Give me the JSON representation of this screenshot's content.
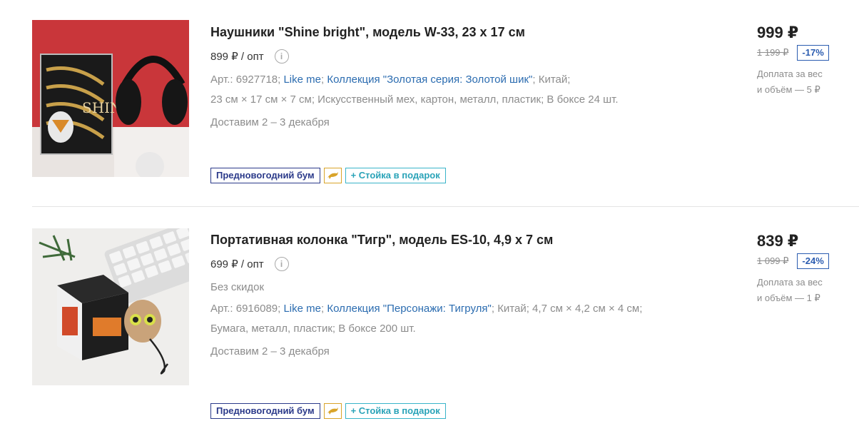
{
  "products": [
    {
      "title": "Наушники \"Shine bright\", модель W-33, 23 х 17 см",
      "opt_price": "899 ₽ / опт",
      "specs_line1": {
        "art": "Арт.: 6927718;",
        "brand": "Like me",
        "sep1": ";",
        "collection": "Коллекция \"Золотая серия: Золотой шик\"",
        "sep2": ";",
        "country": "Китай;"
      },
      "specs_line2": "23 см × 17 см × 7 см;  Искусственный мех, картон, металл, пластик;  В боксе 24 шт.",
      "delivery": "Доставим 2 – 3 декабря",
      "badges": {
        "sale": "Предновогодний бум",
        "gift": "+ Стойка в подарок",
        "dolphin_icon": "dolphin-icon"
      },
      "price": "999 ₽",
      "old_price": "1 199 ₽",
      "discount": "-17%",
      "surcharge_line1": "Доплата за вес",
      "surcharge_line2": "и объём — 5 ₽"
    },
    {
      "title": "Портативная колонка \"Тигр\", модель ES-10, 4,9 х 7 см",
      "opt_price": "699 ₽ / опт",
      "no_discount": "Без скидок",
      "specs_line1": {
        "art": "Арт.: 6916089;",
        "brand": "Like me",
        "sep1": ";",
        "collection": "Коллекция \"Персонажи: Тигруля\"",
        "sep2": ";",
        "country": "Китай;  4,7 см × 4,2 см × 4 см;"
      },
      "specs_line2": "Бумага, металл, пластик;  В боксе 200 шт.",
      "delivery": "Доставим 2 – 3 декабря",
      "badges": {
        "sale": "Предновогодний бум",
        "gift": "+ Стойка в подарок",
        "dolphin_icon": "dolphin-icon"
      },
      "price": "839 ₽",
      "old_price": "1 099 ₽",
      "discount": "-24%",
      "surcharge_line1": "Доплата за вес",
      "surcharge_line2": "и объём — 1 ₽"
    }
  ],
  "colors": {
    "link": "#2b6cb0",
    "sale_badge": "#2b3a8a",
    "gift_badge": "#39b4c9",
    "dolphin_badge": "#d9a42a",
    "discount": "#2b5cb0"
  }
}
